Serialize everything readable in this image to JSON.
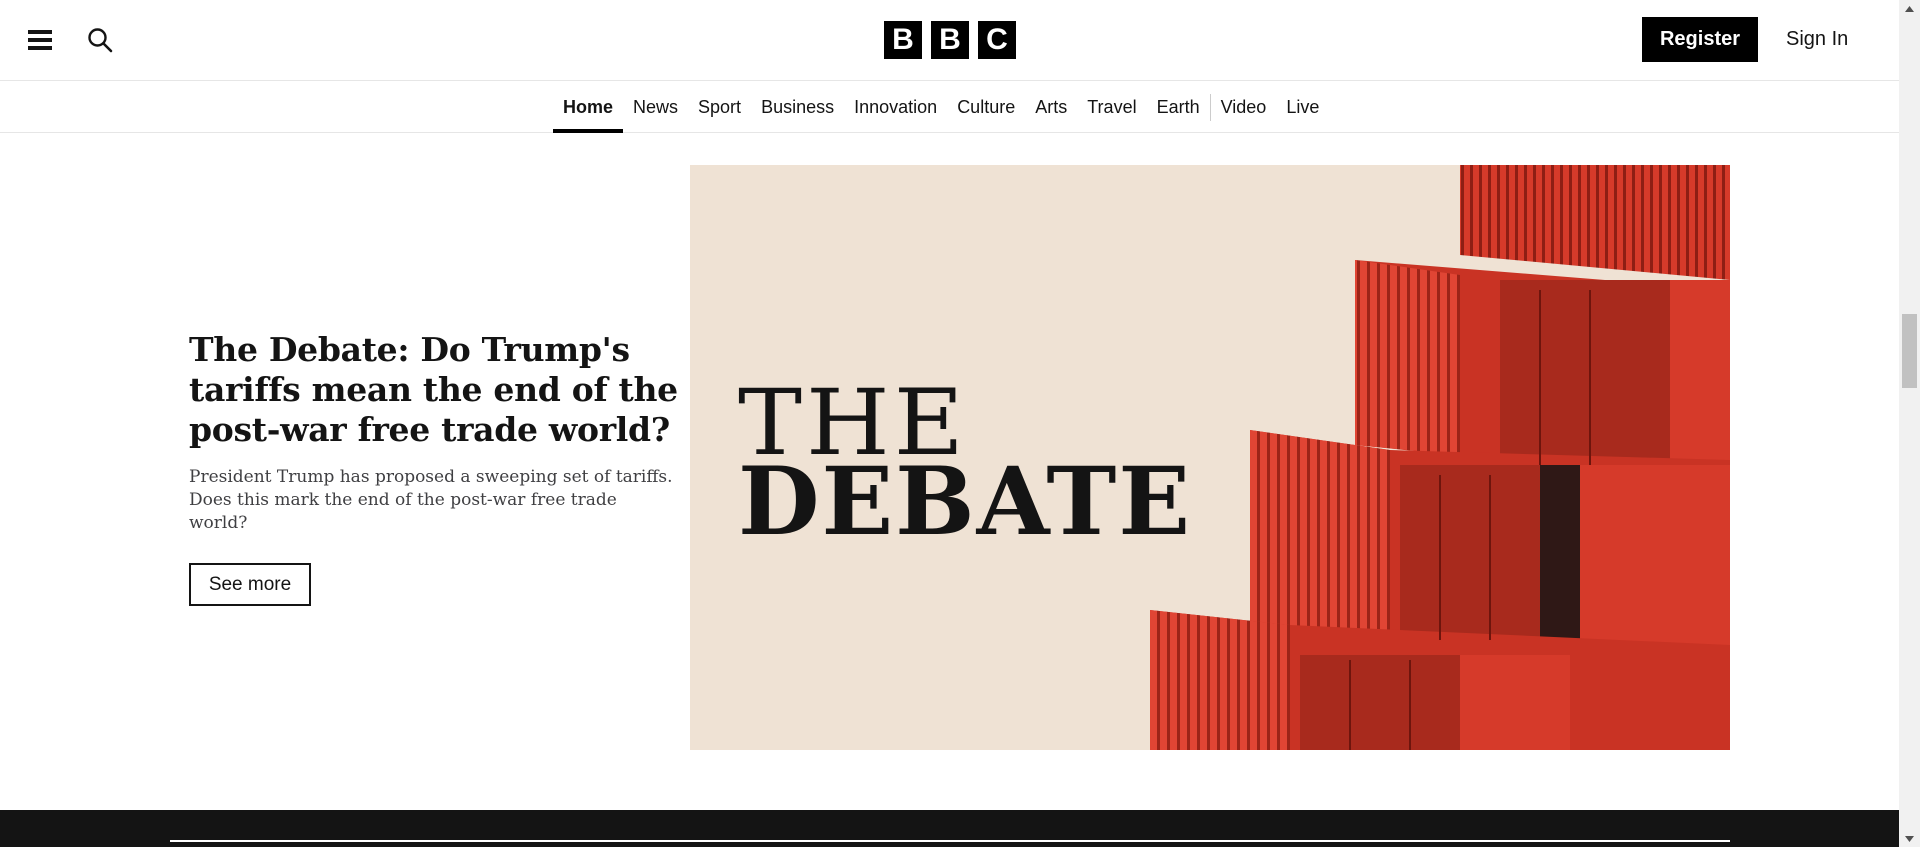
{
  "header": {
    "menu_icon": "hamburger-menu-icon",
    "search_icon": "search-icon",
    "logo_letters": [
      "B",
      "B",
      "C"
    ],
    "register_label": "Register",
    "signin_label": "Sign In"
  },
  "nav": {
    "items": [
      {
        "label": "Home",
        "active": true
      },
      {
        "label": "News"
      },
      {
        "label": "Sport"
      },
      {
        "label": "Business"
      },
      {
        "label": "Innovation"
      },
      {
        "label": "Culture"
      },
      {
        "label": "Arts"
      },
      {
        "label": "Travel"
      },
      {
        "label": "Earth"
      },
      {
        "label": "Video"
      },
      {
        "label": "Live"
      }
    ]
  },
  "feature": {
    "headline": "The Debate: Do Trump's tariffs mean the end of the post-war free trade world?",
    "summary": "President Trump has proposed a sweeping set of tariffs. Does this mark the end of the post-war free trade world?",
    "see_more_label": "See more",
    "image": {
      "title_line1": "THE",
      "title_line2": "DEBATE",
      "background_color": "#efe2d4",
      "container_color": "#d63a2a"
    }
  },
  "colors": {
    "text": "#141414",
    "footer": "#141414",
    "border": "#e6e6e6"
  }
}
